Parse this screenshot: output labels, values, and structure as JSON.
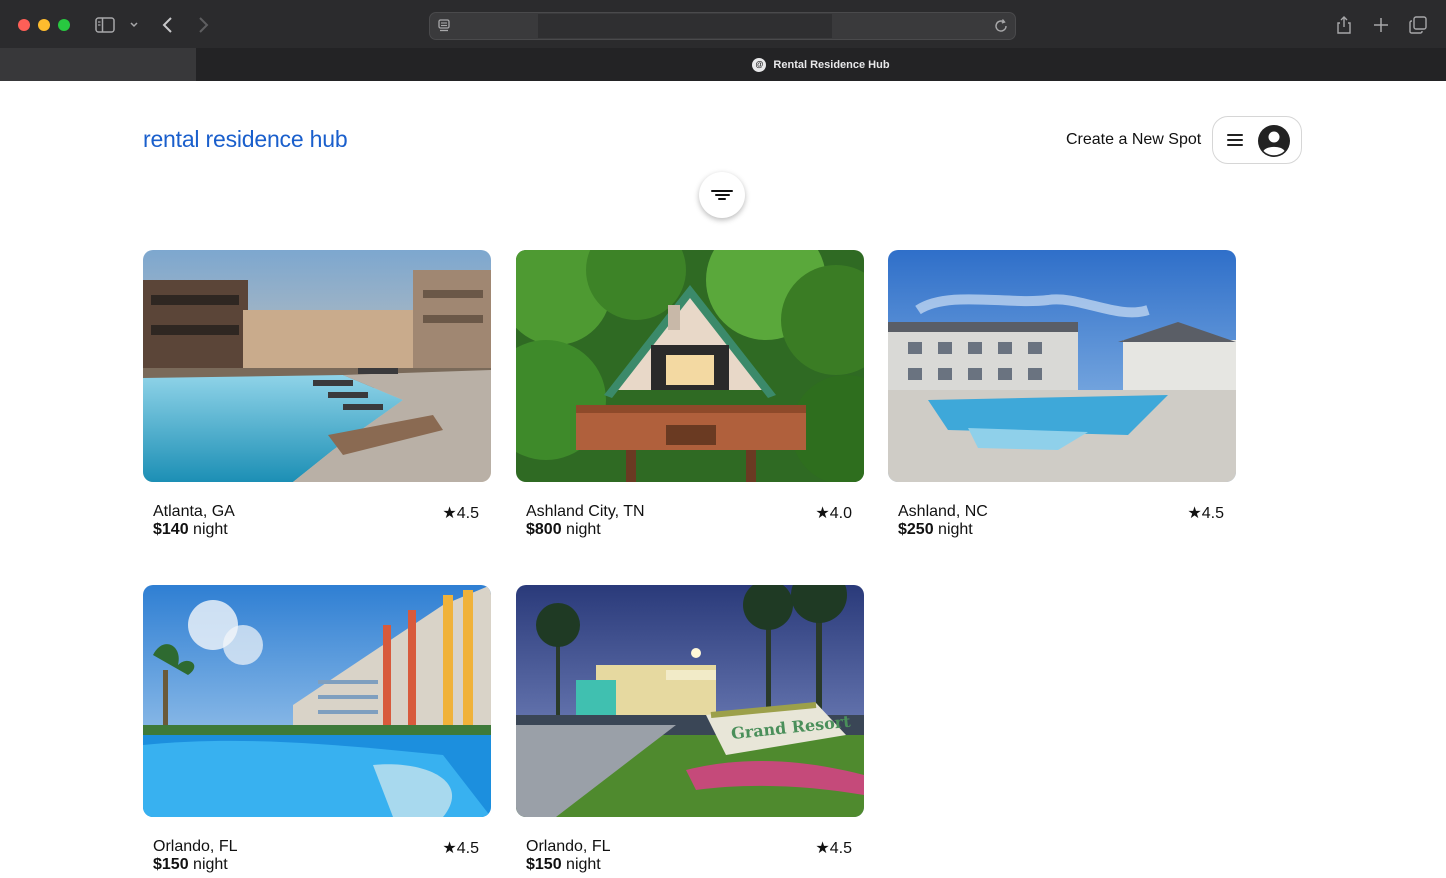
{
  "browser": {
    "tab_title": "Rental Residence Hub",
    "favicon_text": "@"
  },
  "header": {
    "logo": "rental residence hub",
    "create_spot": "Create a New Spot"
  },
  "colors": {
    "brand": "#1a5fcc"
  },
  "icons": {
    "menu": "hamburger-icon",
    "user": "user-avatar-icon",
    "filter": "filter-icon",
    "star": "star-icon"
  },
  "listings": [
    {
      "location": "Atlanta, GA",
      "rating": "★4.5",
      "price": "$140",
      "unit": " night"
    },
    {
      "location": "Ashland City, TN",
      "rating": "★4.0",
      "price": "$800",
      "unit": " night"
    },
    {
      "location": "Ashland, NC",
      "rating": "★4.5",
      "price": "$250",
      "unit": " night"
    },
    {
      "location": "Orlando, FL",
      "rating": "★4.5",
      "price": "$150",
      "unit": " night"
    },
    {
      "location": "Orlando, FL",
      "rating": "★4.5",
      "price": "$150",
      "unit": " night"
    }
  ],
  "sign_text": "Grand Resort"
}
